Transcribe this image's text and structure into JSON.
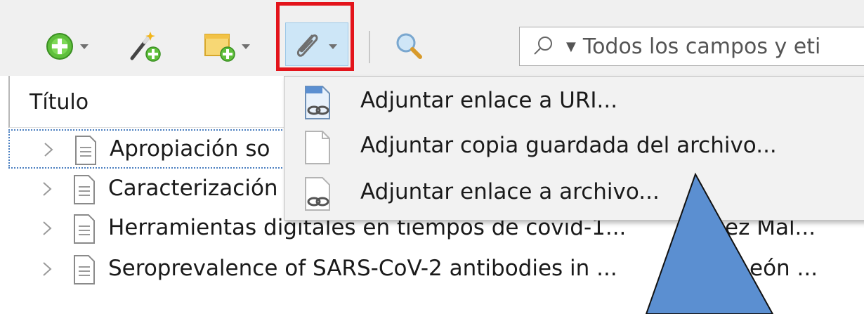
{
  "toolbar": {
    "icons": [
      "new-item-icon",
      "magic-wand-add-icon",
      "new-note-icon",
      "paperclip-icon",
      "advanced-search-icon"
    ],
    "search": {
      "placeholder": "Todos los campos y eti"
    }
  },
  "list": {
    "column_header": "Título",
    "rows": [
      {
        "title": "Apropiación so",
        "selected": true,
        "extra": ""
      },
      {
        "title": "Caracterización",
        "selected": false,
        "extra": ""
      },
      {
        "title": "Herramientas digitales en tiempos de covid-1...",
        "selected": false,
        "extra": "ez Mal..."
      },
      {
        "title": "Seroprevalence of SARS-CoV-2 antibodies in ...",
        "selected": false,
        "extra": "eón ..."
      }
    ]
  },
  "attach_menu": {
    "items": [
      {
        "label": "Adjuntar enlace a URI...",
        "icon": "link-uri-icon"
      },
      {
        "label": "Adjuntar copia guardada del archivo...",
        "icon": "blank-file-icon"
      },
      {
        "label": "Adjuntar enlace a archivo...",
        "icon": "linked-file-icon"
      }
    ]
  },
  "colors": {
    "highlight": "#e3141b",
    "pointer_fill": "#5b8fd1",
    "selection_border": "#4a7ec0"
  }
}
